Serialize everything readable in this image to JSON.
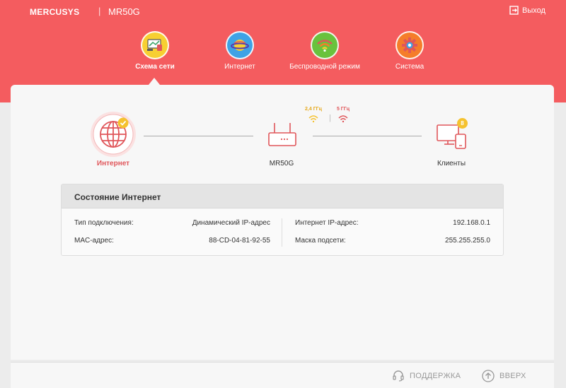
{
  "header": {
    "brand": "MERCUSYS",
    "separator": "|",
    "model": "MR50G",
    "logout_label": "Выход"
  },
  "nav": {
    "items": [
      {
        "label": "Схема сети",
        "icon": "network-map-icon",
        "color": "#f7cf32",
        "active": true
      },
      {
        "label": "Интернет",
        "icon": "globe-planet-icon",
        "color": "#3ea2e5",
        "active": false
      },
      {
        "label": "Беспроводной режим",
        "icon": "wifi-icon",
        "color": "#69c23d",
        "active": false
      },
      {
        "label": "Система",
        "icon": "gear-icon",
        "color": "#f57d2a",
        "active": false
      }
    ]
  },
  "topology": {
    "internet_label": "Интернет",
    "router_label": "MR50G",
    "clients_label": "Клиенты",
    "clients_count": "8",
    "band_24": "2,4 ГГц",
    "band_5": "5 ГГц",
    "band_sep": "|"
  },
  "status": {
    "title": "Состояние Интернет",
    "connection_type_label": "Тип подключения:",
    "connection_type_value": "Динамический IP-адрес",
    "mac_label": "MAC-адрес:",
    "mac_value": "88-CD-04-81-92-55",
    "ip_label": "Интернет IP-адрес:",
    "ip_value": "192.168.0.1",
    "mask_label": "Маска подсети:",
    "mask_value": "255.255.255.0"
  },
  "footer": {
    "support_label": "ПОДДЕРЖКА",
    "top_label": "ВВЕРХ"
  },
  "colors": {
    "brand_red": "#f45c5f",
    "accent_red": "#e0565a",
    "badge_yellow": "#f5c22f"
  }
}
